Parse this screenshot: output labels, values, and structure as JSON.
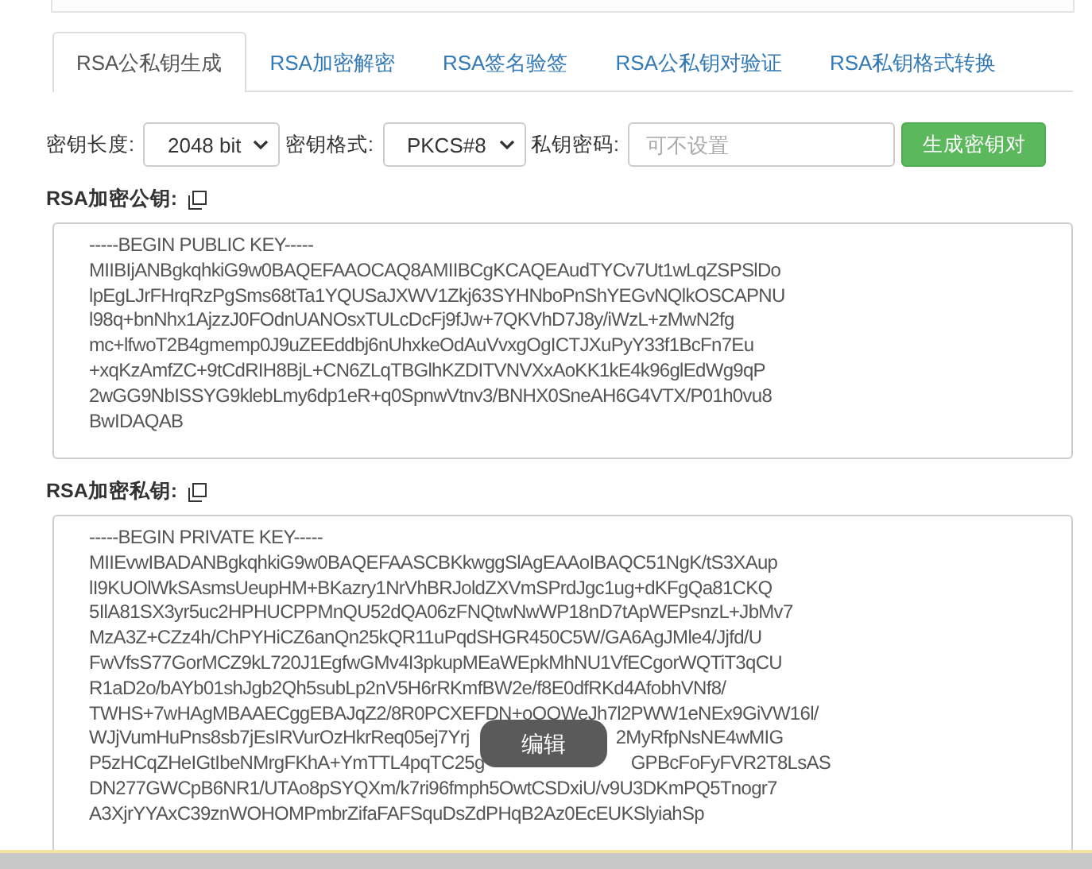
{
  "tabs": [
    {
      "label": "RSA公私钥生成",
      "selected": true
    },
    {
      "label": "RSA加密解密",
      "selected": false
    },
    {
      "label": "RSA签名验签",
      "selected": false
    },
    {
      "label": "RSA公私钥对验证",
      "selected": false
    },
    {
      "label": "RSA私钥格式转换",
      "selected": false
    }
  ],
  "options": {
    "key_length": {
      "label": "密钥长度:",
      "value": "2048 bit"
    },
    "key_format": {
      "label": "密钥格式:",
      "value": "PKCS#8"
    },
    "password": {
      "label": "私钥密码:",
      "placeholder": "可不设置"
    },
    "generate_button": "生成密钥对"
  },
  "public_key": {
    "label": "RSA加密公钥:",
    "lines": [
      "-----BEGIN PUBLIC KEY-----",
      "MIIBIjANBgkqhkiG9w0BAQEFAAOCAQ8AMIIBCgKCAQEAudTYCv7Ut1wLqZSPSlDo",
      "lpEgLJrFHrqRzPgSms68tTa1YQUSaJXWV1Zkj63SYHNboPnShYEGvNQlkOSCAPNU",
      "l98q+bnNhx1AjzzJ0FOdnUANOsxTULcDcFj9fJw+7QKVhD7J8y/iWzL+zMwN2fg",
      "mc+lfwoT2B4gmemp0J9uZEEddbj6nUhxkeOdAuVvxgOgICTJXuPyY33f1BcFn7Eu",
      "+xqKzAmfZC+9tCdRIH8BjL+CN6ZLqTBGlhKZDITVNVXxAoKK1kE4k96glEdWg9qP",
      "2wGG9NbISSYG9klebLmy6dp1eR+q0SpnwVtnv3/BNHX0SneAH6G4VTX/P01h0vu8",
      "BwIDAQAB"
    ]
  },
  "private_key": {
    "label": "RSA加密私钥:",
    "lines": [
      {
        "text": "-----BEGIN PRIVATE KEY-----"
      },
      {
        "text": "MIIEvwIBADANBgkqhkiG9w0BAQEFAASCBKkwggSlAgEAAoIBAQC51NgK/tS3XAup"
      },
      {
        "text": "lI9KUOlWkSAsmsUeupHM+BKazry1NrVhBRJoldZXVmSPrdJgc1ug+dKFgQa81CKQ"
      },
      {
        "text": "5IlA81SX3yr5uc2HPHUCPPMnQU52dQA06zFNQtwNwWP18nD7tApWEPsnzL+JbMv7"
      },
      {
        "text": "MzA3Z+CZz4h/ChPYHiCZ6anQn25kQR11uPqdSHGR450C5W/GA6AgJMle4/Jjfd/U"
      },
      {
        "text": "FwVfsS77GorMCZ9kL720J1EgfwGMv4I3pkupMEaWEpkMhNU1VfECgorWQTiT3qCU"
      },
      {
        "text": "R1aD2o/bAYb01shJgb2Qh5subLp2nV5H6rRKmfBW2e/f8E0dfRKd4AfobhVNf8/"
      },
      {
        "text": "TWHS+7wHAgMBAAECggEBAJqZ2/8R0PCXEFDN+oQOWeJh7l2PWW1eNEx9GiVW16l/"
      },
      {
        "text": "WJjVumHuPns8sb7jEsIRVurOzHkrReq05ej7Yrj",
        "after": "2MyRfpNsNE4wMIG"
      },
      {
        "text": "P5zHCqZHeIGtIbeNMrgFKhA+YmTTL4pqTC25g",
        "after": "GPBcFoFyFVR2T8LsAS"
      },
      {
        "text": "DN277GWCpB6NR1/UTAo8pSYQXm/k7ri96fmph5OwtCSDxiU/v9U3DKmPQ5Tnogr7"
      },
      {
        "text": "A3XjrYYAxC39znWOHOMPmbrZifaFAFSquDsZdPHqB2Az0EcEUKSlyiahSp"
      }
    ],
    "overlay_button": "编辑"
  }
}
